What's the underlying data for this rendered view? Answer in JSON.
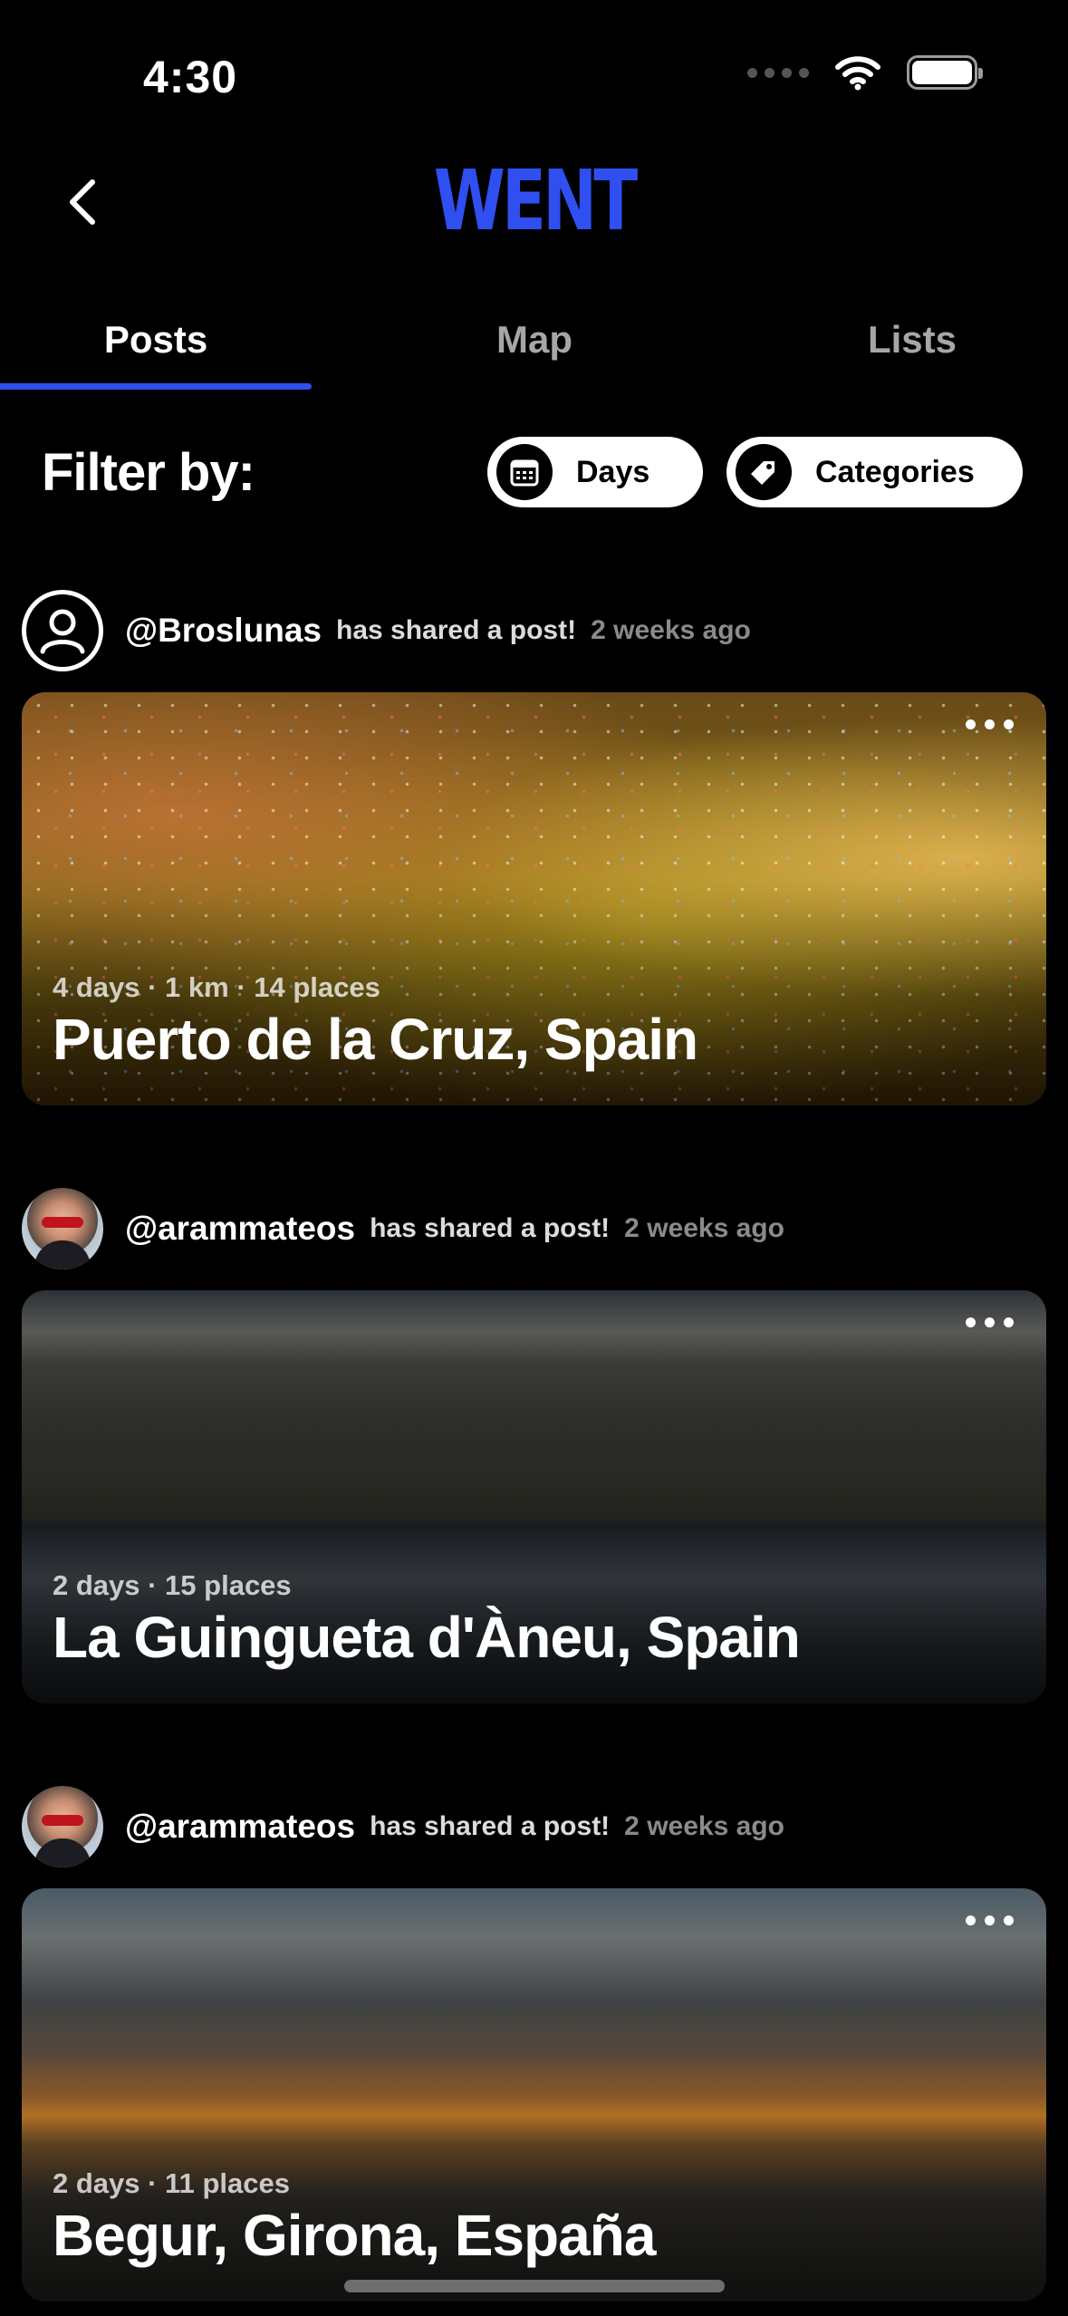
{
  "status_bar": {
    "time": "4:30"
  },
  "header": {
    "logo": "WENT"
  },
  "tabs": [
    {
      "label": "Posts",
      "active": true
    },
    {
      "label": "Map",
      "active": false
    },
    {
      "label": "Lists",
      "active": false
    }
  ],
  "filter": {
    "label": "Filter by:",
    "chips": [
      {
        "label": "Days",
        "icon": "calendar-icon"
      },
      {
        "label": "Categories",
        "icon": "tag-icon"
      }
    ]
  },
  "posts": [
    {
      "username": "@Broslunas",
      "action": "has shared a post!",
      "time_ago": "2 weeks ago",
      "meta": "4 days · 1 km · 14 places",
      "title": "Puerto de la Cruz, Spain"
    },
    {
      "username": "@arammateos",
      "action": "has shared a post!",
      "time_ago": "2 weeks ago",
      "meta": "2 days · 15 places",
      "title": "La Guingueta d'Àneu, Spain"
    },
    {
      "username": "@arammateos",
      "action": "has shared a post!",
      "time_ago": "2 weeks ago",
      "meta": "2 days · 11 places",
      "title": "Begur, Girona, España"
    }
  ],
  "colors": {
    "accent": "#2f4ff0",
    "background": "#000000"
  }
}
